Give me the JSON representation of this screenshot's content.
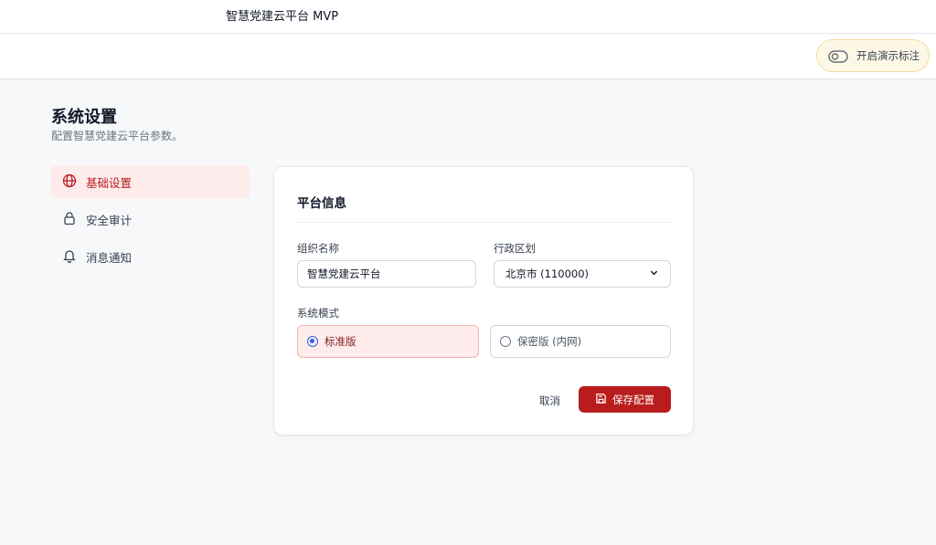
{
  "header": {
    "title": "智慧党建云平台 MVP"
  },
  "toolbar": {
    "demo_toggle_label": "开启演示标注"
  },
  "page": {
    "title": "系统设置",
    "subtitle": "配置智慧党建云平台参数。"
  },
  "sidebar": {
    "items": [
      {
        "label": "基础设置",
        "icon": "globe-icon",
        "active": true
      },
      {
        "label": "安全审计",
        "icon": "lock-icon",
        "active": false
      },
      {
        "label": "消息通知",
        "icon": "bell-icon",
        "active": false
      }
    ]
  },
  "form": {
    "section_title": "平台信息",
    "org_name": {
      "label": "组织名称",
      "value": "智慧党建云平台"
    },
    "region": {
      "label": "行政区划",
      "value": "北京市 (110000)"
    },
    "mode": {
      "label": "系统模式",
      "options": [
        {
          "label": "标准版",
          "selected": true
        },
        {
          "label": "保密版 (内网)",
          "selected": false
        }
      ]
    },
    "cancel_label": "取消",
    "save_label": "保存配置"
  },
  "colors": {
    "accent": "#b91c1c",
    "accent_bg": "#fdeceb",
    "radio": "#2563eb"
  }
}
